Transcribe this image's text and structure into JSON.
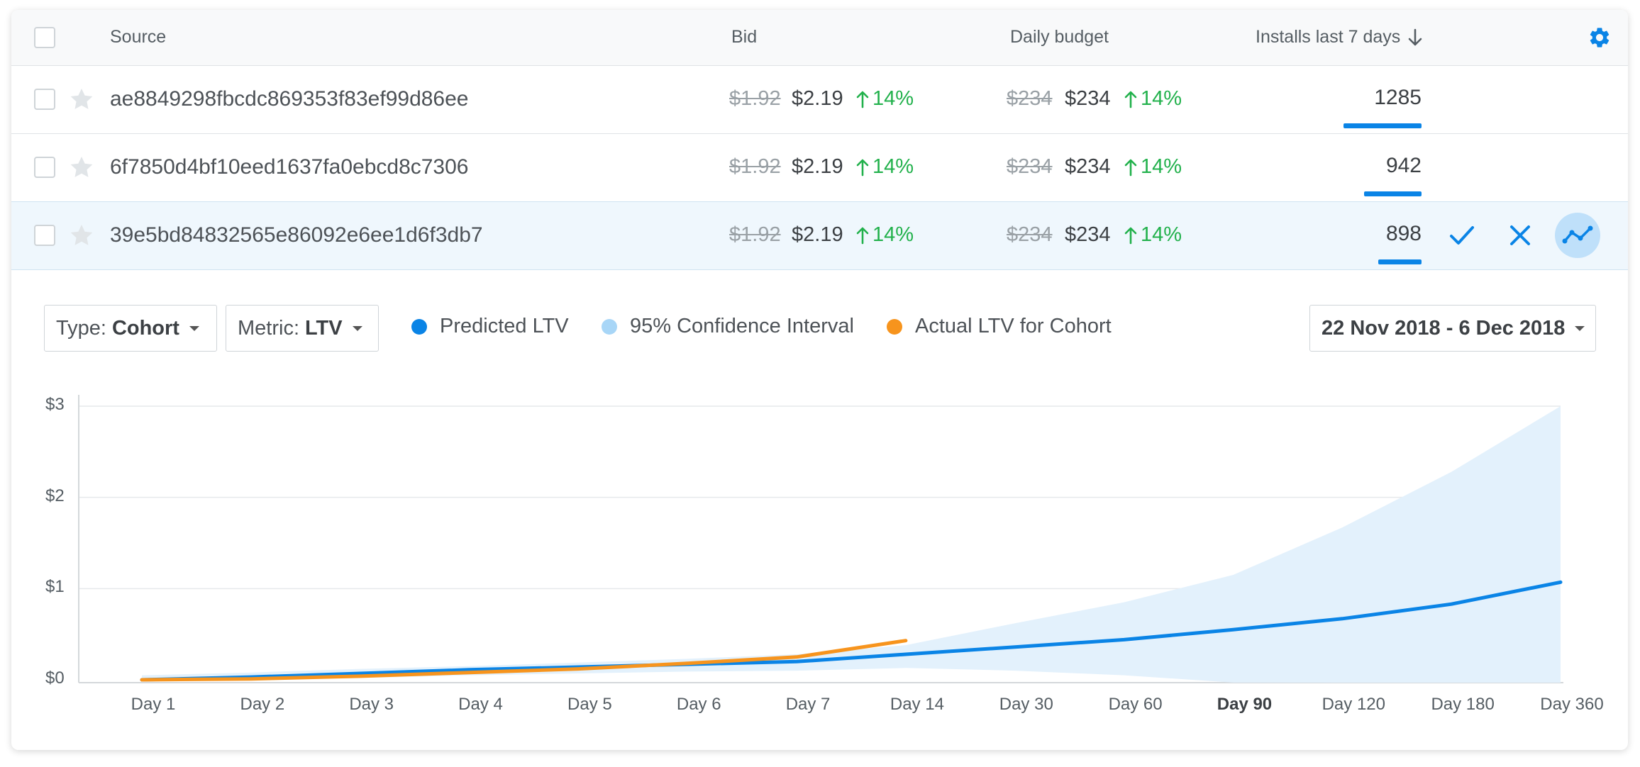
{
  "table": {
    "headers": {
      "source": "Source",
      "bid": "Bid",
      "budget": "Daily budget",
      "installs": "Installs last 7 days"
    },
    "rows": [
      {
        "source": "ae8849298fbcdc869353f83ef99d86ee",
        "bid_old": "$1.92",
        "bid_new": "$2.19",
        "bid_change": "14%",
        "budget_old": "$234",
        "budget_new": "$234",
        "budget_change": "14%",
        "installs": "1285",
        "installs_fraction": 1.0
      },
      {
        "source": "6f7850d4bf10eed1637fa0ebcd8c7306",
        "bid_old": "$1.92",
        "bid_new": "$2.19",
        "bid_change": "14%",
        "budget_old": "$234",
        "budget_new": "$234",
        "budget_change": "14%",
        "installs": "942",
        "installs_fraction": 0.733
      },
      {
        "source": "39e5bd84832565e86092e6ee1d6f3db7",
        "bid_old": "$1.92",
        "bid_new": "$2.19",
        "bid_change": "14%",
        "budget_old": "$234",
        "budget_new": "$234",
        "budget_change": "14%",
        "installs": "898",
        "installs_fraction": 0.55
      }
    ]
  },
  "controls": {
    "type_label": "Type:",
    "type_value": "Cohort",
    "metric_label": "Metric:",
    "metric_value": "LTV",
    "date_range": "22 Nov 2018 - 6 Dec 2018"
  },
  "colors": {
    "accent": "#0a84e6",
    "ci": "#a8d6f7",
    "actual": "#f7941d",
    "positive": "#22b14c"
  },
  "chart_data": {
    "type": "line",
    "categories": [
      "Day 1",
      "Day 2",
      "Day 3",
      "Day 4",
      "Day 5",
      "Day 6",
      "Day 7",
      "Day 14",
      "Day 30",
      "Day 60",
      "Day 90",
      "Day 120",
      "Day 180",
      "Day 360"
    ],
    "highlighted_category": "Day 90",
    "y_ticks": [
      "$0",
      "$1",
      "$2",
      "$3"
    ],
    "ylim": [
      0,
      3
    ],
    "grid": true,
    "legend_position": "top",
    "series": [
      {
        "name": "Predicted LTV",
        "values": [
          0.0,
          0.03,
          0.07,
          0.11,
          0.14,
          0.17,
          0.2,
          0.28,
          0.36,
          0.44,
          0.55,
          0.67,
          0.83,
          1.07
        ]
      },
      {
        "name": "95% Confidence Interval",
        "lower": [
          0.0,
          0.0,
          0.02,
          0.05,
          0.07,
          0.09,
          0.1,
          0.13,
          0.1,
          0.05,
          -0.03,
          -0.06,
          -0.06,
          -0.06
        ],
        "upper": [
          0.05,
          0.08,
          0.12,
          0.15,
          0.19,
          0.23,
          0.28,
          0.38,
          0.62,
          0.85,
          1.15,
          1.67,
          2.28,
          3.0
        ]
      },
      {
        "name": "Actual LTV for Cohort",
        "values": [
          0.0,
          0.01,
          0.04,
          0.08,
          0.12,
          0.18,
          0.25,
          0.43
        ]
      }
    ]
  }
}
